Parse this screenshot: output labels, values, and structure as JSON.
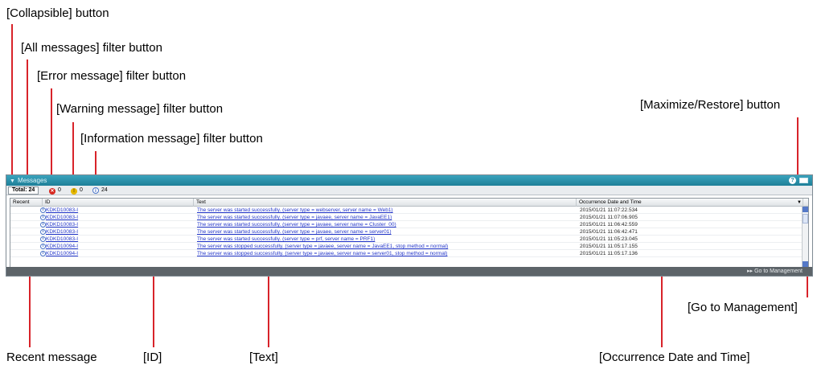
{
  "callouts": {
    "collapsible": "[Collapsible]  button",
    "all_messages": "[All messages]  filter button",
    "error_message": "[Error message]  filter button",
    "warning_message": "[Warning message]  filter button",
    "info_message": "[Information message]  filter button",
    "maximize_restore": "[Maximize/Restore]  button",
    "go_to_management": "[Go to Management]",
    "recent_message": "Recent message",
    "id": "[ID]",
    "text": "[Text]",
    "occurrence": "[Occurrence Date and Time]"
  },
  "panel": {
    "title": "Messages",
    "help_icon": "help-icon",
    "maximize_icon": "maximize-icon"
  },
  "filters": {
    "total_label": "Total: 24",
    "error_count": "0",
    "warning_count": "0",
    "info_count": "24"
  },
  "columns": {
    "recent": "Recent",
    "id": "ID",
    "text": "Text",
    "occurrence": "Occurrence Date and Time"
  },
  "rows": [
    {
      "id": "KDKD10083-I",
      "text": "The server was started successfully. (server type = webserver, server name = Web1)",
      "time": "2015/01/21 11:07:22.534"
    },
    {
      "id": "KDKD10083-I",
      "text": "The server was started successfully. (server type = javaee, server name = JavaEE1)",
      "time": "2015/01/21 11:07:06.905"
    },
    {
      "id": "KDKD10083-I",
      "text": "The server was started successfully. (server type = javaee, server name = Cluster_00)",
      "time": "2015/01/21 11:06:42.559"
    },
    {
      "id": "KDKD10083-I",
      "text": "The server was started successfully. (server type = javaee, server name = server01)",
      "time": "2015/01/21 11:06:42.471"
    },
    {
      "id": "KDKD10083-I",
      "text": "The server was started successfully. (server type = prf, server name = PRF1)",
      "time": "2015/01/21 11:05:23.045"
    },
    {
      "id": "KDKD10094-I",
      "text": "The server was stopped successfully. (server type = javaee, server name = JavaEE1, stop method = normal)",
      "time": "2015/01/21 11:05:17.155"
    },
    {
      "id": "KDKD10094-I",
      "text": "The server was stopped successfully. (server type = javaee, server name = server01, stop method = normal)",
      "time": "2015/01/21 11:05:17.136"
    }
  ],
  "footer": {
    "go_to_management": "▸▸ Go to Management"
  },
  "colors": {
    "titlebar": "#1e7f98",
    "leader_line": "#d8232a",
    "link": "#2235c9"
  }
}
